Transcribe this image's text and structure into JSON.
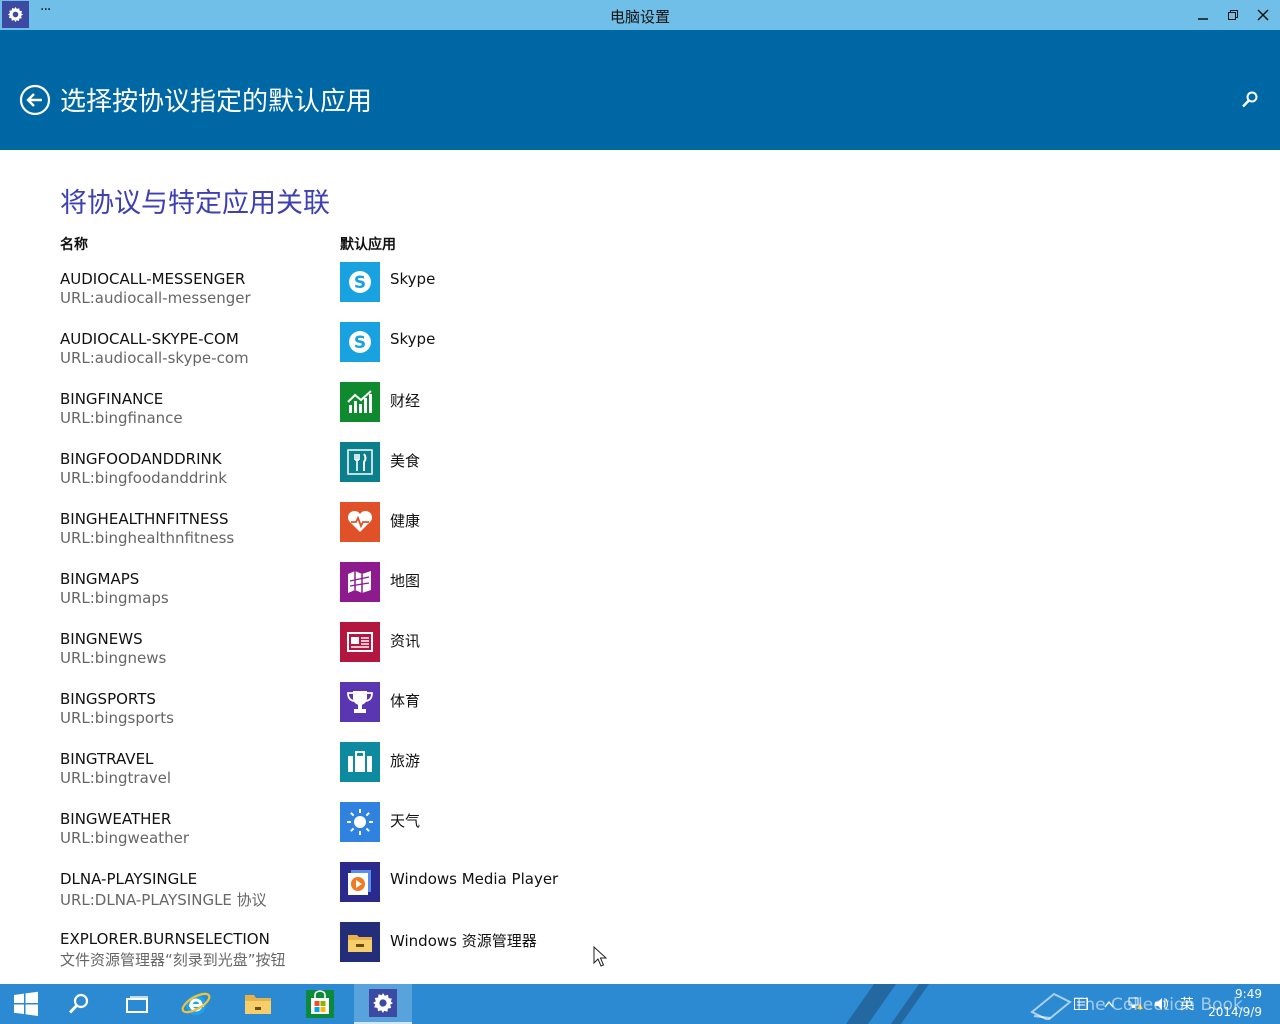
{
  "window": {
    "title": "电脑设置",
    "menu_label": "···"
  },
  "header": {
    "title": "选择按协议指定的默认应用"
  },
  "section": {
    "title": "将协议与特定应用关联",
    "col_name": "名称",
    "col_default_app": "默认应用"
  },
  "rows": [
    {
      "name": "AUDIOCALL-MESSENGER",
      "desc": "URL:audiocall-messenger",
      "app": "Skype",
      "icon": "skype-icon",
      "color": "#1aa2e0"
    },
    {
      "name": "AUDIOCALL-SKYPE-COM",
      "desc": "URL:audiocall-skype-com",
      "app": "Skype",
      "icon": "skype-icon",
      "color": "#1aa2e0"
    },
    {
      "name": "BINGFINANCE",
      "desc": "URL:bingfinance",
      "app": "财经",
      "icon": "finance-chart-icon",
      "color": "#108a2e"
    },
    {
      "name": "BINGFOODANDDRINK",
      "desc": "URL:bingfoodanddrink",
      "app": "美食",
      "icon": "fork-knife-icon",
      "color": "#0b7f8c"
    },
    {
      "name": "BINGHEALTHNFITNESS",
      "desc": "URL:binghealthnfitness",
      "app": "健康",
      "icon": "heart-pulse-icon",
      "color": "#e0512a"
    },
    {
      "name": "BINGMAPS",
      "desc": "URL:bingmaps",
      "app": "地图",
      "icon": "map-icon",
      "color": "#8e1b8e"
    },
    {
      "name": "BINGNEWS",
      "desc": "URL:bingnews",
      "app": "资讯",
      "icon": "newspaper-icon",
      "color": "#b3163f"
    },
    {
      "name": "BINGSPORTS",
      "desc": "URL:bingsports",
      "app": "体育",
      "icon": "trophy-icon",
      "color": "#5b36b1"
    },
    {
      "name": "BINGTRAVEL",
      "desc": "URL:bingtravel",
      "app": "旅游",
      "icon": "suitcase-icon",
      "color": "#0e8aa0"
    },
    {
      "name": "BINGWEATHER",
      "desc": "URL:bingweather",
      "app": "天气",
      "icon": "sun-icon",
      "color": "#2f82e0"
    },
    {
      "name": "DLNA-PLAYSINGLE",
      "desc": "URL:DLNA-PLAYSINGLE 协议",
      "app": "Windows Media Player",
      "icon": "media-player-icon",
      "color": "#2a2a8c"
    },
    {
      "name": "EXPLORER.BURNSELECTION",
      "desc": "文件资源管理器“刻录到光盘”按钮",
      "app": "Windows 资源管理器",
      "icon": "folder-icon",
      "color": "#232d7a"
    }
  ],
  "taskbar": {
    "items": [
      "start-icon",
      "search-icon",
      "task-view-icon",
      "internet-explorer-icon",
      "file-explorer-icon",
      "store-icon",
      "settings-icon"
    ],
    "clock_time": "9:49",
    "clock_date": "2014/9/9",
    "ime_label": "英",
    "watermark": "The Collection Book"
  }
}
